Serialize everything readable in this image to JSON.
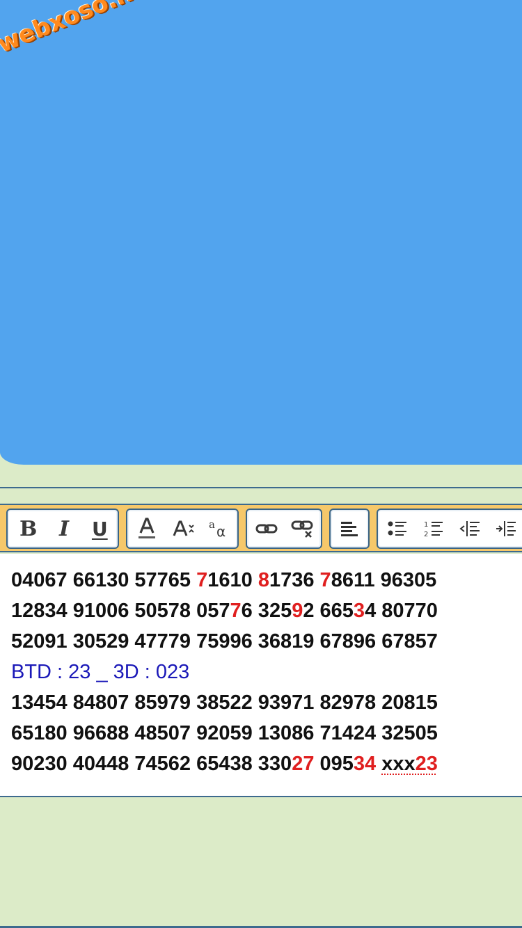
{
  "watermark": "webxoso.net",
  "colors": {
    "canvas_blue": "#52a4ee",
    "page_bg": "#dcebc8",
    "toolbar_bg": "#f6c86a",
    "number_red": "#e01f1f",
    "btd_blue": "#1b19b8"
  },
  "toolbar": {
    "bold_label": "B",
    "italic_label": "I",
    "underline_label": "U",
    "icons": [
      "text-color-icon",
      "font-size-icon",
      "font-face-icon",
      "link-icon",
      "unlink-icon",
      "align-left-icon",
      "bullet-list-icon",
      "numbered-list-icon",
      "outdent-icon",
      "indent-icon"
    ]
  },
  "editor": {
    "lines": [
      [
        {
          "t": "04067 66130 57765 "
        },
        {
          "t": "7",
          "red": true
        },
        {
          "t": "1610 "
        },
        {
          "t": "8",
          "red": true
        },
        {
          "t": "1736 "
        },
        {
          "t": "7",
          "red": true
        },
        {
          "t": "8611 96305"
        }
      ],
      [
        {
          "t": "12834 91006 50578 057"
        },
        {
          "t": "7",
          "red": true
        },
        {
          "t": "6 325"
        },
        {
          "t": "9",
          "red": true
        },
        {
          "t": "2 665"
        },
        {
          "t": "3",
          "red": true
        },
        {
          "t": "4 80770"
        }
      ],
      [
        {
          "t": "52091 30529 47779 75996 36819 67896 67857"
        }
      ],
      [
        {
          "t": "BTD : 23 _ 3D : 023",
          "blue": true
        }
      ],
      [
        {
          "t": "13454 84807 85979 38522 93971 82978 20815"
        }
      ],
      [
        {
          "t": "65180 96688 48507 92059 13086 71424 32505"
        }
      ],
      [
        {
          "t": "90230 40448 74562 65438 330"
        },
        {
          "t": "27",
          "red": true
        },
        {
          "t": " 095"
        },
        {
          "t": "34",
          "red": true
        },
        {
          "t": " "
        },
        {
          "t": "xxx",
          "spell": true
        },
        {
          "t": "23",
          "red": true,
          "spell": true
        }
      ]
    ]
  }
}
